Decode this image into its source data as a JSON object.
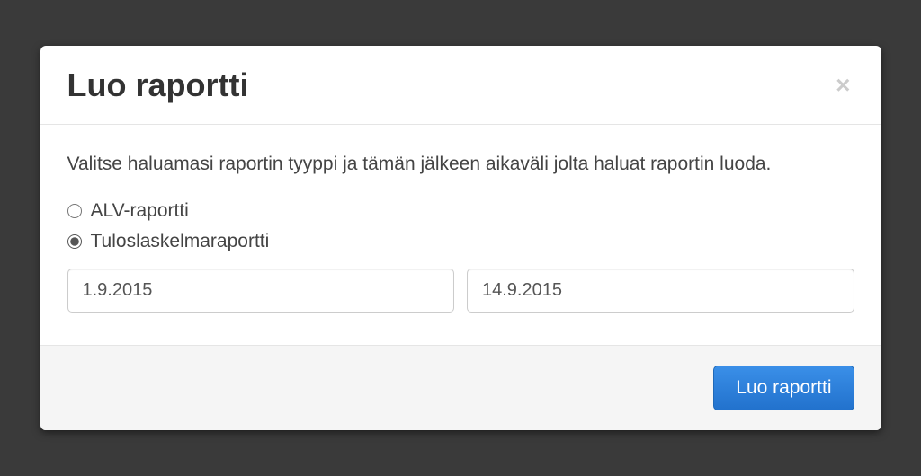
{
  "modal": {
    "title": "Luo raportti",
    "close_symbol": "×",
    "instructions": "Valitse haluamasi raportin tyyppi ja tämän jälkeen aikaväli jolta haluat raportin luoda.",
    "radios": {
      "alv": {
        "label": "ALV-raportti",
        "checked": false
      },
      "tulos": {
        "label": "Tuloslaskelmaraportti",
        "checked": true
      }
    },
    "dates": {
      "start": "1.9.2015",
      "end": "14.9.2015"
    },
    "footer": {
      "submit_label": "Luo raportti"
    }
  }
}
